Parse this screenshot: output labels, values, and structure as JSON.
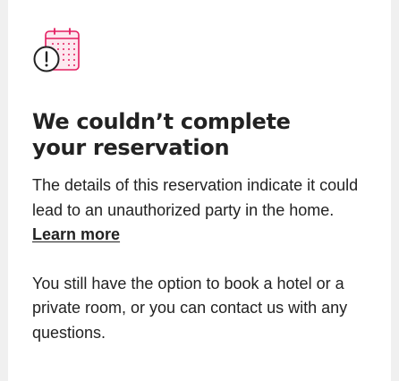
{
  "icon": {
    "name": "calendar-warning-icon",
    "accent_color": "#e31c5f",
    "fill_color": "#fde8ef",
    "outline_color": "#222222"
  },
  "heading": {
    "title": "We couldn’t complete your reservation"
  },
  "message": {
    "paragraph1_text": "The details of this reservation indicate it could lead to an unauthorized party in the home. ",
    "learn_more_label": "Learn more",
    "paragraph2_text": "You still have the option to book a hotel or a private room, or you can contact us with any questions."
  }
}
